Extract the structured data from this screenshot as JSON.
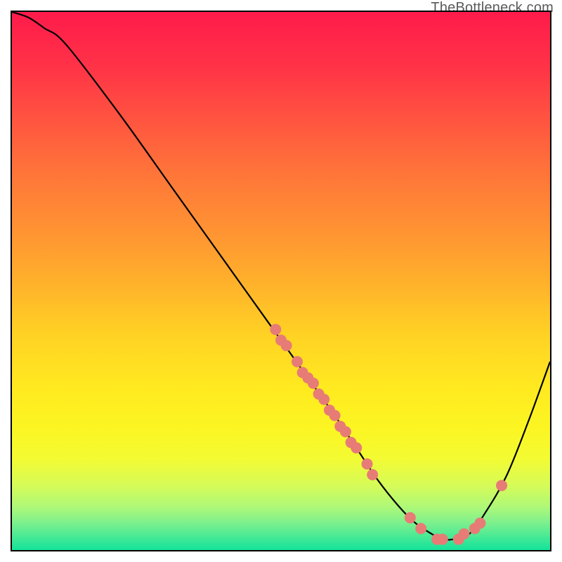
{
  "attribution": "TheBottleneck.com",
  "chart_data": {
    "type": "line",
    "title": "",
    "xlabel": "",
    "ylabel": "",
    "xlim": [
      0,
      100
    ],
    "ylim": [
      0,
      100
    ],
    "grid": false,
    "series": [
      {
        "name": "bottleneck-curve",
        "x": [
          0,
          3,
          6,
          10,
          20,
          30,
          40,
          50,
          55,
          60,
          64,
          68,
          72,
          75,
          78,
          80,
          82,
          85,
          88,
          92,
          96,
          100
        ],
        "values": [
          100,
          99,
          97,
          94,
          81,
          67,
          53,
          39,
          32,
          25,
          19,
          13,
          8,
          5,
          3,
          2,
          2,
          3,
          7,
          14,
          24,
          35
        ]
      }
    ],
    "points": [
      {
        "x": 49,
        "y": 41
      },
      {
        "x": 50,
        "y": 39
      },
      {
        "x": 51,
        "y": 38
      },
      {
        "x": 53,
        "y": 35
      },
      {
        "x": 54,
        "y": 33
      },
      {
        "x": 55,
        "y": 32
      },
      {
        "x": 56,
        "y": 31
      },
      {
        "x": 57,
        "y": 29
      },
      {
        "x": 58,
        "y": 28
      },
      {
        "x": 59,
        "y": 26
      },
      {
        "x": 60,
        "y": 25
      },
      {
        "x": 61,
        "y": 23
      },
      {
        "x": 62,
        "y": 22
      },
      {
        "x": 63,
        "y": 20
      },
      {
        "x": 64,
        "y": 19
      },
      {
        "x": 66,
        "y": 16
      },
      {
        "x": 67,
        "y": 14
      },
      {
        "x": 74,
        "y": 6
      },
      {
        "x": 76,
        "y": 4
      },
      {
        "x": 79,
        "y": 2
      },
      {
        "x": 80,
        "y": 2
      },
      {
        "x": 83,
        "y": 2
      },
      {
        "x": 84,
        "y": 3
      },
      {
        "x": 86,
        "y": 4
      },
      {
        "x": 87,
        "y": 5
      },
      {
        "x": 91,
        "y": 12
      }
    ],
    "gradient_stops": [
      {
        "offset": 0.0,
        "color": "#ff1b4b"
      },
      {
        "offset": 0.1,
        "color": "#ff3247"
      },
      {
        "offset": 0.2,
        "color": "#ff5440"
      },
      {
        "offset": 0.3,
        "color": "#ff7539"
      },
      {
        "offset": 0.4,
        "color": "#ff9133"
      },
      {
        "offset": 0.5,
        "color": "#ffb02b"
      },
      {
        "offset": 0.6,
        "color": "#ffd224"
      },
      {
        "offset": 0.7,
        "color": "#ffea20"
      },
      {
        "offset": 0.77,
        "color": "#fcf522"
      },
      {
        "offset": 0.83,
        "color": "#f3fb32"
      },
      {
        "offset": 0.88,
        "color": "#d6fb58"
      },
      {
        "offset": 0.92,
        "color": "#aef878"
      },
      {
        "offset": 0.95,
        "color": "#7cf08e"
      },
      {
        "offset": 0.98,
        "color": "#3de896"
      },
      {
        "offset": 1.0,
        "color": "#13e39b"
      }
    ],
    "point_style": {
      "fill": "#e77c76",
      "radius": 8
    },
    "curve_style": {
      "stroke": "#000000",
      "width": 2.2
    }
  }
}
